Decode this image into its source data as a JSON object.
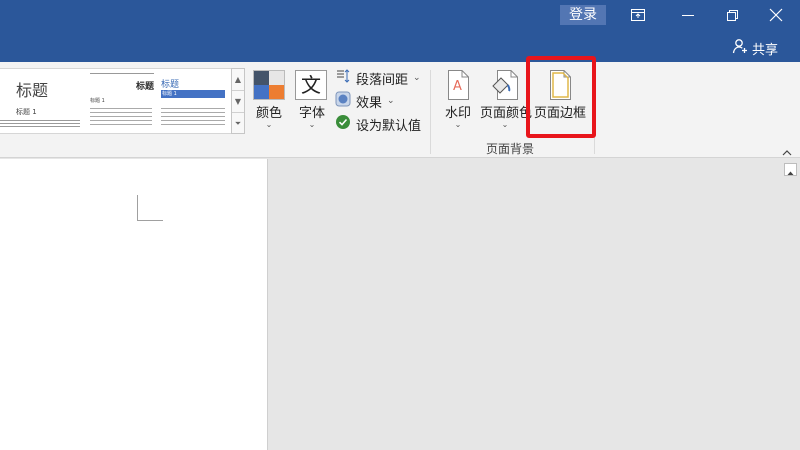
{
  "titlebar": {
    "login_label": "登录",
    "controls": [
      {
        "name": "ribbon-display-icon"
      },
      {
        "name": "minimize-icon"
      },
      {
        "name": "restore-icon"
      },
      {
        "name": "close-icon"
      }
    ]
  },
  "share": {
    "label": "共享"
  },
  "style_gallery": {
    "items": [
      {
        "title": "标题",
        "subtitle": "标题 1"
      },
      {
        "title": "标题",
        "subtitle": "标题 1"
      },
      {
        "title": "标题",
        "subtitle": "标题 1"
      }
    ]
  },
  "design_group": {
    "colors_label": "颜色",
    "fonts_label": "字体",
    "fonts_glyph": "文",
    "paragraph_spacing_label": "段落间距",
    "effects_label": "效果",
    "set_default_label": "设为默认值"
  },
  "page_background_group": {
    "label": "页面背景",
    "watermark_label": "水印",
    "page_color_label": "页面颜色",
    "page_borders_label": "页面边框"
  },
  "colors": {
    "title_bar": "#2b579a",
    "highlight": "#e8151b"
  }
}
